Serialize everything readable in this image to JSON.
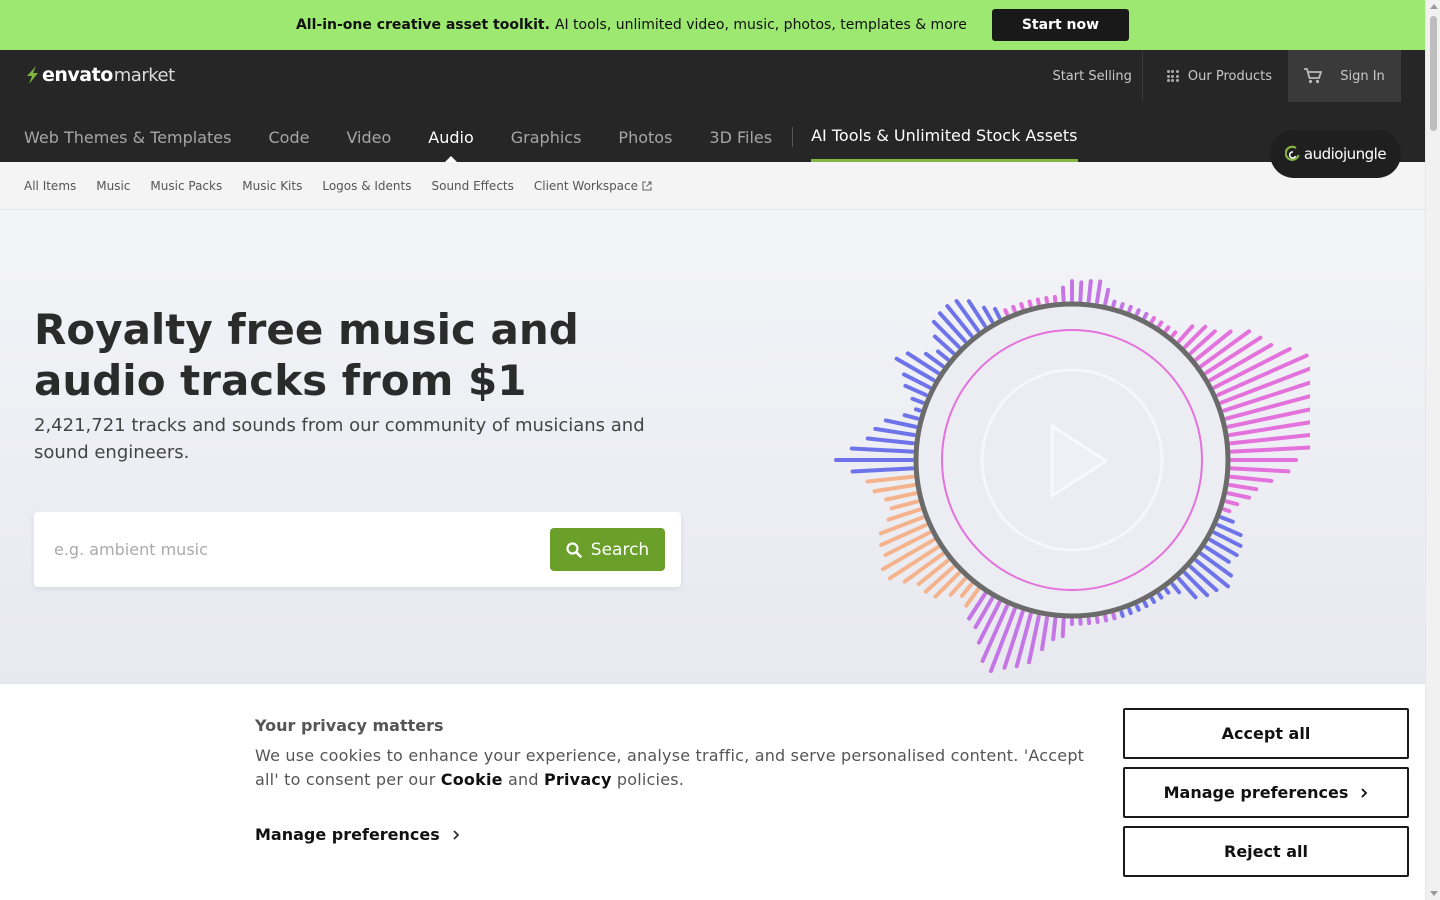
{
  "promo": {
    "bold": "All-in-one creative asset toolkit.",
    "text": "AI tools, unlimited video, music, photos, templates & more",
    "cta": "Start now"
  },
  "header": {
    "logo_brand": "envato",
    "logo_market": "market",
    "start_selling": "Start Selling",
    "our_products": "Our Products",
    "sign_in": "Sign In",
    "categories": [
      "Web Themes & Templates",
      "Code",
      "Video",
      "Audio",
      "Graphics",
      "Photos",
      "3D Files"
    ],
    "active_category": "Audio",
    "ai_link": "AI Tools & Unlimited Stock Assets",
    "site_badge": "audiojungle"
  },
  "subnav": [
    "All Items",
    "Music",
    "Music Packs",
    "Music Kits",
    "Logos & Idents",
    "Sound Effects",
    "Client Workspace"
  ],
  "hero": {
    "title": "Royalty free music and audio tracks from $1",
    "subtitle": "2,421,721 tracks and sounds from our community of musicians and sound engineers.",
    "search_placeholder": "e.g. ambient music",
    "search_button": "Search"
  },
  "cookie": {
    "heading": "Your privacy matters",
    "msg_part1": "We use cookies to enhance your experience, analyse traffic, and serve personalised content. 'Accept all' to consent per our ",
    "cookie_link": "Cookie",
    "msg_and": " and ",
    "privacy_link": "Privacy",
    "msg_end": " policies.",
    "manage_link": "Manage preferences",
    "accept_all": "Accept all",
    "manage_button": "Manage preferences",
    "reject_all": "Reject all"
  },
  "colors": {
    "promo_bg": "#9ce870",
    "header_bg": "#262626",
    "search_green": "#6a9f2a",
    "ai_underline": "#82b541",
    "wave_pink": "#e472dc",
    "wave_violet": "#c476e6",
    "wave_blue": "#6f73ea",
    "wave_peach": "#f5b38d"
  }
}
